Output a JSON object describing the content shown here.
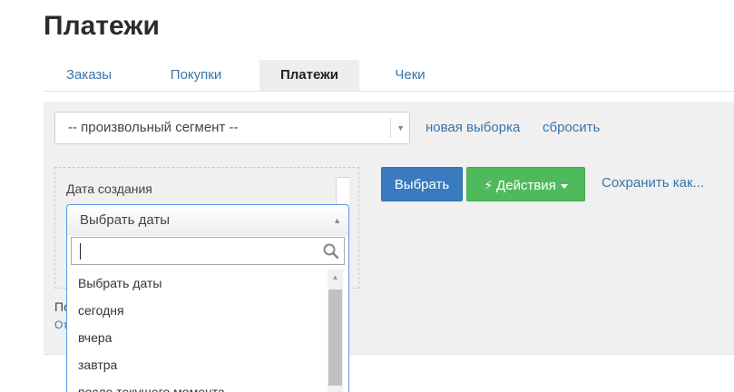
{
  "page": {
    "title": "Платежи"
  },
  "tabs": [
    {
      "label": "Заказы"
    },
    {
      "label": "Покупки"
    },
    {
      "label": "Платежи",
      "active": true
    },
    {
      "label": "Чеки"
    }
  ],
  "segment": {
    "value": "-- произвольный сегмент --",
    "new_selection": "новая выборка",
    "reset": "сбросить"
  },
  "filter": {
    "label": "Дата создания",
    "select_value": "Выбрать даты",
    "search_placeholder": "",
    "options": [
      "Выбрать даты",
      "сегодня",
      "вчера",
      "завтра",
      "после текущего момента"
    ]
  },
  "actions": {
    "select_button": "Выбрать",
    "actions_button": "Действия",
    "save_as": "Сохранить как..."
  },
  "below": {
    "text_fragment": "По",
    "link_fragment": "От"
  },
  "colors": {
    "link": "#3a73a8",
    "primary": "#3a7bbf",
    "success": "#4fba5b",
    "focus": "#5b97e4"
  }
}
